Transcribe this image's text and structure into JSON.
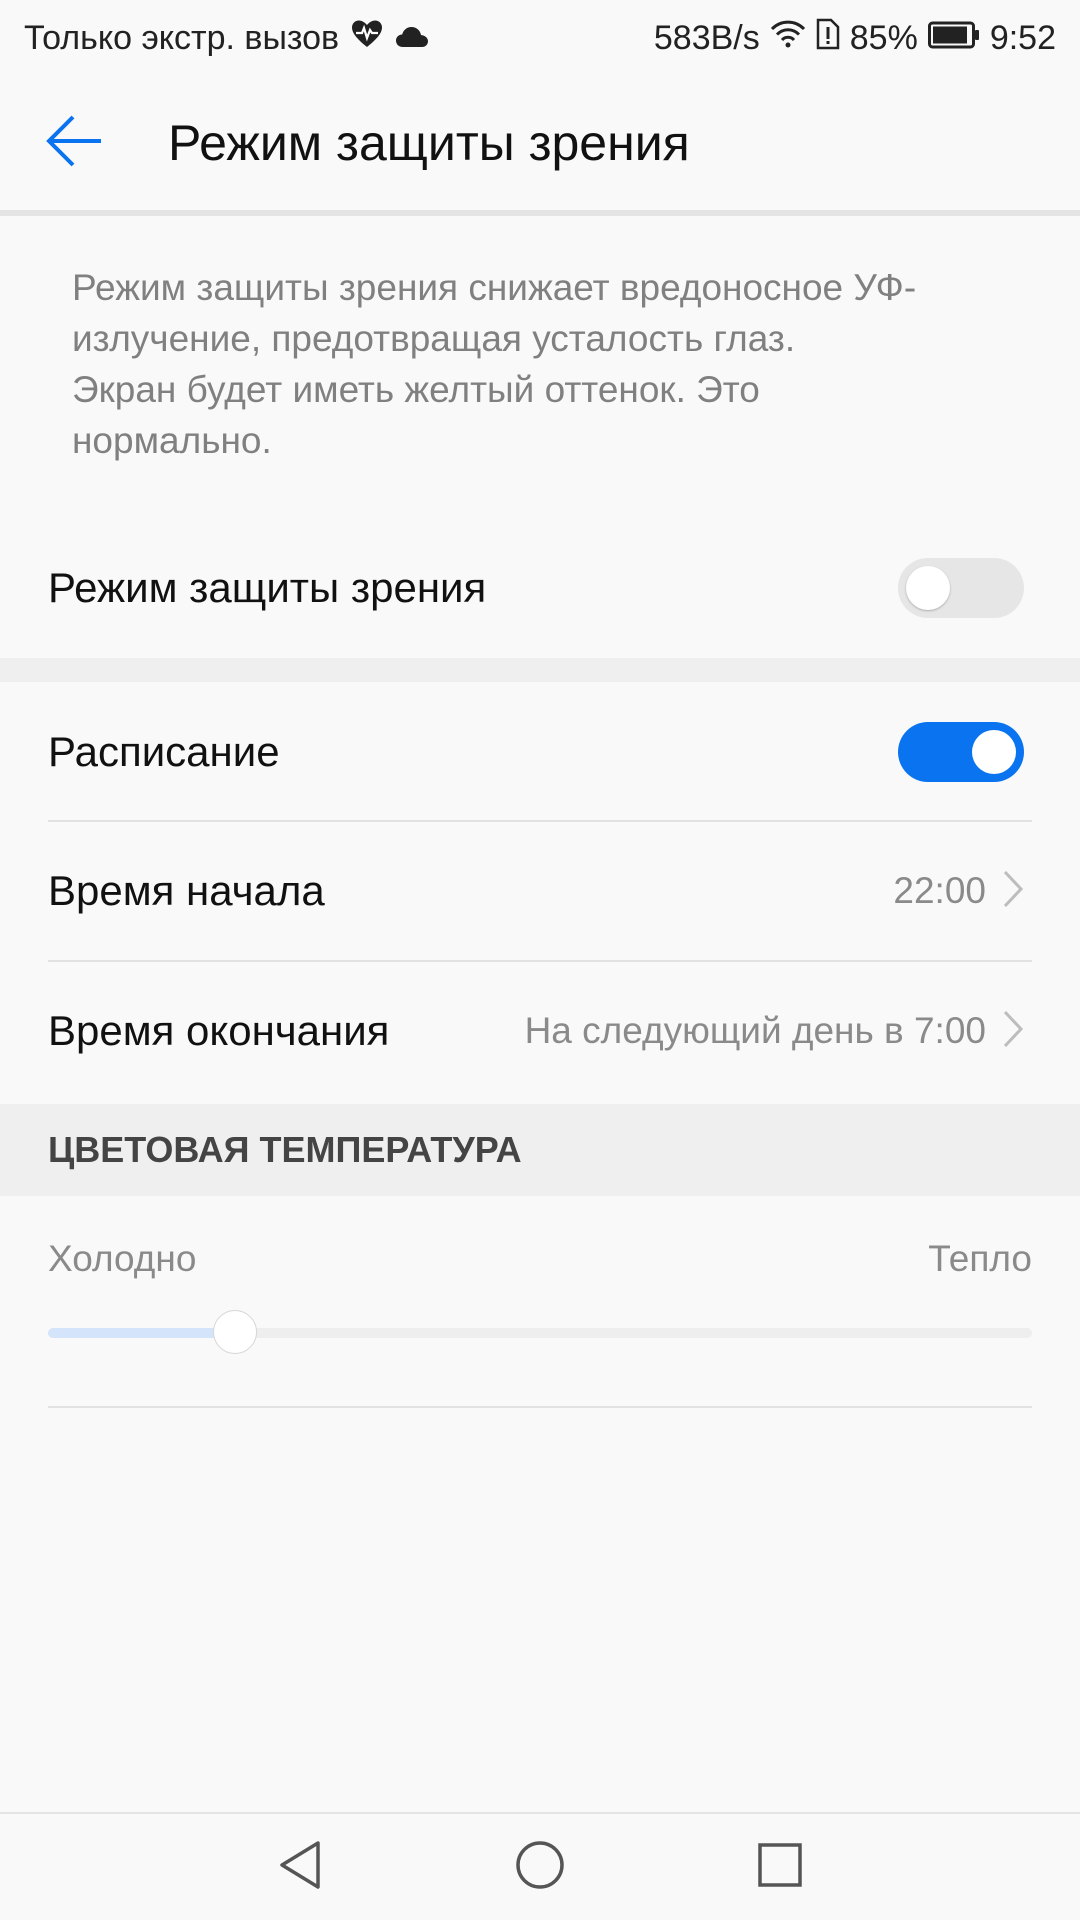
{
  "status_bar": {
    "carrier_text": "Только экстр. вызов",
    "icons_left": [
      "heart-pulse-icon",
      "cloud-icon"
    ],
    "net_speed": "583B/s",
    "battery_percent": "85%",
    "time": "9:52",
    "icons_right": [
      "wifi-icon",
      "sim-alert-icon",
      "battery-icon"
    ]
  },
  "app_bar": {
    "back_icon": "arrow-left-icon",
    "title": "Режим защиты зрения",
    "accent_color": "#0a73f0"
  },
  "description": {
    "line1": "Режим защиты зрения снижает вредоносное УФ-",
    "line2": "излучение, предотвращая усталость глаз.",
    "line3": "Экран будет иметь желтый оттенок. Это",
    "line4": "нормально."
  },
  "eye_mode": {
    "label": "Режим защиты зрения",
    "enabled": false
  },
  "schedule": {
    "label": "Расписание",
    "enabled": true
  },
  "start_time": {
    "label": "Время начала",
    "value": "22:00",
    "icon": "chevron-right-icon"
  },
  "end_time": {
    "label": "Время окончания",
    "value": "На следующий день в 7:00",
    "icon": "chevron-right-icon"
  },
  "color_temperature": {
    "header": "ЦВЕТОВАЯ ТЕМПЕРАТУРА",
    "min_label": "Холодно",
    "max_label": "Тепло",
    "level": 0.19
  },
  "nav_bar": {
    "buttons": [
      "back-triangle-icon",
      "home-circle-icon",
      "recents-square-icon"
    ]
  }
}
